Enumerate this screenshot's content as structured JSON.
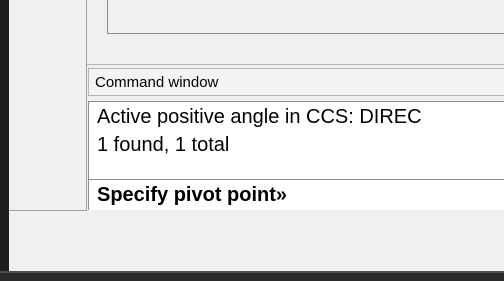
{
  "command_window": {
    "title": "Command window",
    "output_lines": [
      "Active positive angle in CCS: DIREC",
      "1 found, 1 total"
    ],
    "prompt": "Specify pivot point»"
  }
}
